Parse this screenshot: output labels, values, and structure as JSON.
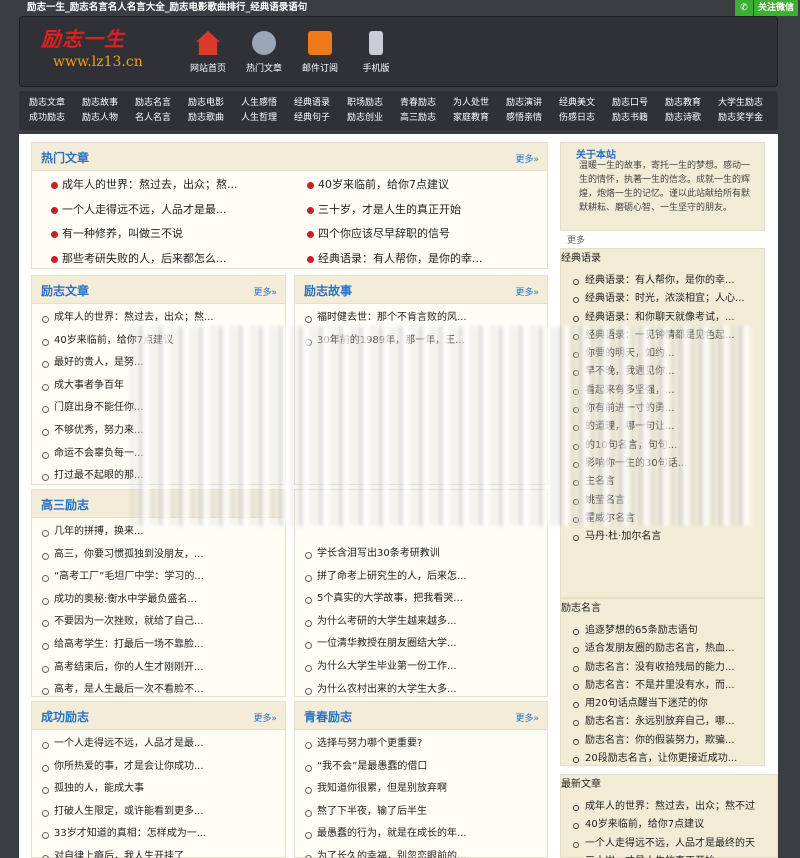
{
  "topbar": {
    "text": "励志一生_励志名言名人名言大全_励志电影歌曲排行_经典语录语句",
    "wechat_label": "关注微信"
  },
  "header": {
    "logo_cn": "励志一生",
    "logo_url": "www.lz13.cn",
    "nav": [
      {
        "label": "网站首页",
        "icon": "home-icon"
      },
      {
        "label": "热门文章",
        "icon": "hot-article-icon"
      },
      {
        "label": "邮件订阅",
        "icon": "rss-icon"
      },
      {
        "label": "手机版",
        "icon": "mobile-icon"
      }
    ]
  },
  "categories": {
    "row1": [
      "励志文章",
      "励志故事",
      "励志名言",
      "励志电影",
      "人生感悟",
      "经典语录",
      "职场励志",
      "青春励志",
      "为人处世",
      "励志演讲",
      "经典美文",
      "励志口号",
      "励志教育",
      "大学生励志"
    ],
    "row2": [
      "成功励志",
      "励志人物",
      "名人名言",
      "励志歌曲",
      "人生哲理",
      "经典句子",
      "励志创业",
      "高三励志",
      "家庭教育",
      "感悟亲情",
      "伤感日志",
      "励志书籍",
      "励志诗歌",
      "励志奖学金"
    ]
  },
  "more": "更多»",
  "hot": {
    "title": "热门文章",
    "items": [
      "成年人的世界：熬过去，出众；熬...",
      "40岁来临前，给你7点建议",
      "一个人走得远不远，人品才是最...",
      "三十岁，才是人生的真正开始",
      "有一种修养，叫做三不说",
      "四个你应该尽早辞职的信号",
      "那些考研失败的人，后来都怎么...",
      "经典语录：有人帮你，是你的幸..."
    ]
  },
  "lizhi_wenzhang": {
    "title": "励志文章",
    "items": [
      "成年人的世界：熬过去，出众；熬...",
      "40岁来临前，给你7点建议",
      "最好的贵人，是努...",
      "成大事者争百年",
      "门庭出身不能任你...",
      "不够优秀，努力来...",
      "命运不会辜负每一...",
      "打过最不起眼的那..."
    ]
  },
  "lizhi_gushi": {
    "title": "励志故事",
    "items": [
      "福时健去世：那个不肯言败的风...",
      "30年前的1989年，那一年，王..."
    ]
  },
  "gaosan": {
    "title": "高三励志",
    "items": [
      "几年的拼搏，换来...",
      "高三，你要习惯孤独到没朋友，...",
      "“高考工厂”毛坦厂中学：学习的...",
      "成功的奥秘:衡水中学最负盛名...",
      "不要因为一次挫败，就给了自己...",
      "给高考学生：打最后一场不靠脸...",
      "高考结束后，你的人生才刚刚开...",
      "高考，是人生最后一次不看脸不..."
    ]
  },
  "mid_right": {
    "items": [
      "学长含泪写出30条考研教训",
      "拼了命考上研究生的人，后来怎...",
      "5个真实的大学故事，把我看哭...",
      "为什么考研的大学生越来越多...",
      "一位清华教授在朋友圈结大学...",
      "为什么大学生毕业第一份工作...",
      "为什么农村出来的大学生大多..."
    ]
  },
  "chenggong": {
    "title": "成功励志",
    "items": [
      "一个人走得远不远，人品才是最...",
      "你所热爱的事，才是会让你成功...",
      "孤独的人，能成大事",
      "打破人生限定，或许能看到更多...",
      "33岁才知道的真相：怎样成为一...",
      "对自律上瘾后，我人生开挂了"
    ]
  },
  "qingchun": {
    "title": "青春励志",
    "items": [
      "选择与努力哪个更重要?",
      "“我不会”是最愚蠢的借口",
      "我知道你很累，但是别放弃啊",
      "熬了下半夜，输了后半生",
      "最愚蠢的行为，就是在成长的年...",
      "为了长久的幸福，别忽恋眼前的..."
    ]
  },
  "side_about": {
    "title": "关于本站",
    "text": "温暖一生的故事，寄托一生的梦想。感动一生的情怀，执著一生的信念。成就一生的辉煌，炮烙一生的记忆。谨以此站献给所有默默耕耘、磨砺心智、一生坚守的朋友。",
    "more": "更多"
  },
  "side_yulu": {
    "title": "经典语录",
    "items": [
      "经典语录：有人帮你，是你的幸...",
      "经典语录：时光，浓淡相宜；人心...",
      "经典语录：和你聊天就像考试，...",
      "经典语录：一见钟情都是见色起...",
      "你要的明天，如约...",
      "早不晚，我遇见你...",
      "看起来有多坚强，...",
      "你有前进一寸的勇...",
      "的道理，哪一句让...",
      "的10句名言，句句...",
      "影响你一生的30句话...",
      "主名言",
      "姚莹名言",
      "霍威尔名言",
      "马丹·杜·加尔名言"
    ]
  },
  "side_mingyan": {
    "title": "励志名言",
    "items": [
      "追逐梦想的65条励志语句",
      "适合发朋友圈的励志名言，热血...",
      "励志名言：没有收拾残局的能力...",
      "励志名言：不是井里没有水，而...",
      "用20句话点醒当下迷茫的你",
      "励志名言：永远别放弃自己，哪...",
      "励志名言：你的假装努力，欺骗...",
      "20段励志名言，让你更接近成功..."
    ]
  },
  "side_new": {
    "title": "最新文章",
    "items": [
      "成年人的世界：熬过去，出众；熬不过",
      "40岁来临前，给你7点建议",
      "一个人走得远不远，人品才是最终的天",
      "三十岁，才是人生的真正开始"
    ]
  }
}
